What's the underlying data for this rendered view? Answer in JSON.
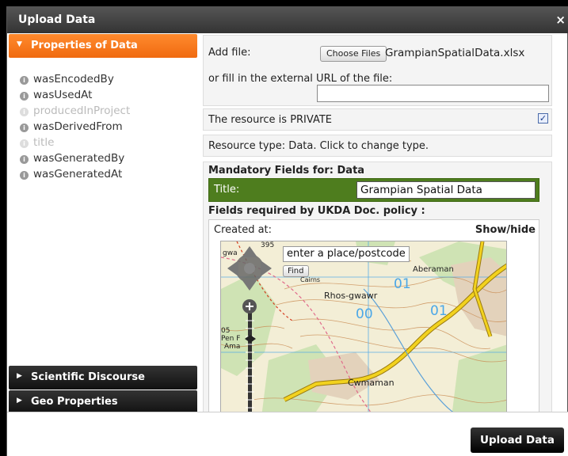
{
  "dialog": {
    "title": "Upload Data",
    "close_glyph": "×"
  },
  "sidebar": {
    "properties_header": "Properties of Data",
    "properties": [
      {
        "label": "wasEncodedBy",
        "enabled": true
      },
      {
        "label": "wasUsedAt",
        "enabled": true
      },
      {
        "label": "producedInProject",
        "enabled": false
      },
      {
        "label": "wasDerivedFrom",
        "enabled": true
      },
      {
        "label": "title",
        "enabled": false
      },
      {
        "label": "wasGeneratedBy",
        "enabled": true
      },
      {
        "label": "wasGeneratedAt",
        "enabled": true
      }
    ],
    "info_glyph": "i",
    "scientific_header": "Scientific Discourse",
    "geo_header": "Geo Properties"
  },
  "file": {
    "add_label": "Add file:",
    "choose_button": "Choose Files",
    "file_name": "GrampianSpatialData.xlsx",
    "or_label": "or fill in the external URL of the file:",
    "url_value": ""
  },
  "privacy": {
    "label": "The resource is PRIVATE",
    "checked": true,
    "check_glyph": "✓"
  },
  "resource_type": {
    "label": "Resource type: Data. Click to change type."
  },
  "mandatory": {
    "header": "Mandatory Fields for: Data",
    "title_label": "Title:",
    "title_value": "Grampian Spatial Data",
    "required_header": "Fields required by UKDA Doc. policy :",
    "created_label": "Created at:",
    "show_hide": "Show/hide"
  },
  "map": {
    "search_placeholder": "enter a place/postcode",
    "find_button": "Find",
    "labels": {
      "n395": "395",
      "gwa": "gwa",
      "cairns": "Cairns",
      "aberaman": "Aberaman",
      "rhos": "Rhos-gwawr",
      "n05": "05",
      "pen": "Pen F",
      "ama": "Ama",
      "cwmaman": "Cwmaman",
      "g01": "01",
      "g00": "00",
      "g01b": "01"
    },
    "colors": {
      "road_yellow": "#f2d21e",
      "road_red": "#d43b1e",
      "contour": "#c98b52",
      "grid": "#4aa7e8",
      "woodland": "#cfe3b4",
      "built": "#e0d0b8"
    }
  },
  "footer": {
    "upload_button": "Upload Data"
  },
  "colors": {
    "accent_orange": "#f07a1e",
    "title_green": "#4e7d1e"
  }
}
